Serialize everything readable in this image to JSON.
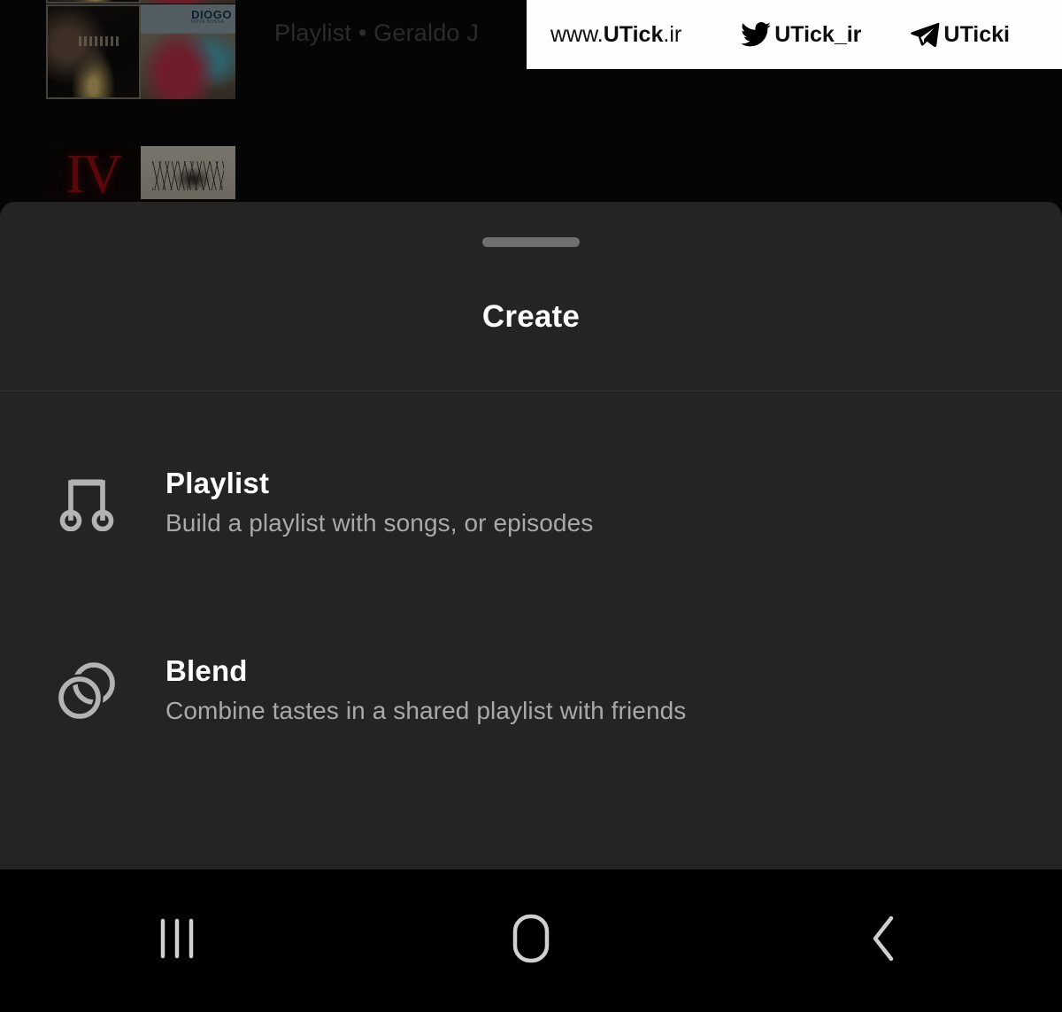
{
  "watermark": {
    "site_prefix": "www.",
    "site_brand": "UTick",
    "site_suffix": ".ir",
    "twitter_icon": "twitter-bird-icon",
    "twitter_handle": "UTick_ir",
    "telegram_icon": "telegram-plane-icon",
    "telegram_handle": "UTicki"
  },
  "backdrop": {
    "playlist_meta": "Playlist • Geraldo J",
    "albums": [
      {
        "name": "album-art-portrait-dark"
      },
      {
        "name": "album-art-diogo-car",
        "label": "DIOGO",
        "sub": "NOVA BOSSA"
      },
      {
        "name": "album-art-iv-red",
        "label": "IV"
      },
      {
        "name": "album-art-grass-sepia"
      }
    ]
  },
  "sheet": {
    "grabber": "drag-handle",
    "title": "Create",
    "options": [
      {
        "icon": "music-note-icon",
        "title": "Playlist",
        "subtitle": "Build a playlist with songs, or episodes"
      },
      {
        "icon": "blend-circles-icon",
        "title": "Blend",
        "subtitle": "Combine tastes in a shared playlist with friends"
      }
    ]
  },
  "navbar": {
    "recents_label": "recents-icon",
    "home_label": "home-icon",
    "back_label": "back-icon"
  },
  "colors": {
    "sheet_bg": "#242424",
    "page_bg": "#090909",
    "navbar_bg": "#000000",
    "primary_text": "#ffffff",
    "secondary_text": "#a9a9a9",
    "icon_gray": "#b3b3b3",
    "grabber": "#6f6f6f"
  }
}
